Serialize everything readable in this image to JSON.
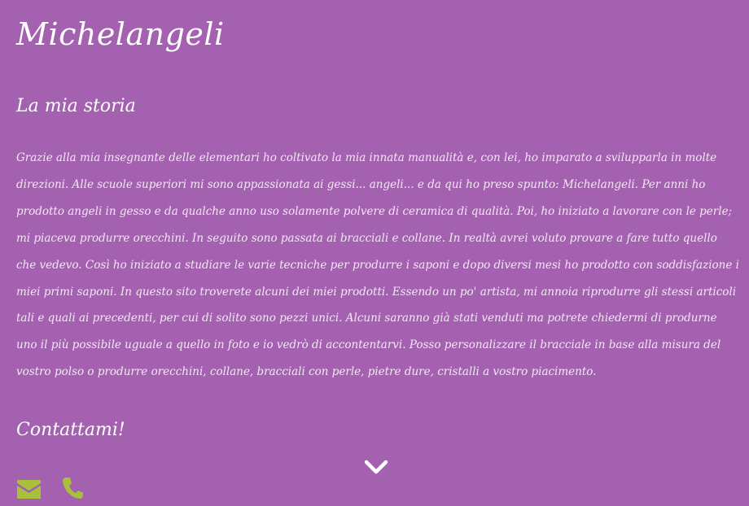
{
  "site": {
    "title": "Michelangeli"
  },
  "story": {
    "title": "La mia storia",
    "text": "Grazie alla mia insegnante delle elementari ho coltivato la mia innata manualità e, con lei, ho imparato a svilupparla in molte direzioni. Alle scuole superiori mi sono appassionata ai gessi... angeli... e da qui ho preso spunto: Michelangeli. Per anni ho prodotto angeli in gesso e da qualche anno uso solamente polvere di ceramica di qualità. Poi, ho iniziato a lavorare con le perle; mi piaceva produrre orecchini. In seguito sono passata ai bracciali e collane. In realtà avrei voluto provare a fare tutto quello che vedevo. Così ho iniziato a studiare le varie tecniche per produrre i saponi e dopo diversi mesi ho prodotto con soddisfazione i miei primi saponi. In questo sito troverete alcuni dei miei prodotti. Essendo un po' artista, mi annoia riprodurre gli stessi articoli tali e quali ai precedenti, per cui di solito sono pezzi unici. Alcuni saranno già stati venduti ma potrete chiedermi di produrne uno il più possibile uguale a quello in foto e io vedrò di accontentarvi. Posso personalizzare il bracciale in base alla misura del vostro polso o produrre orecchini, collane, bracciali con perle, pietre dure, cristalli a vostro piacimento."
  },
  "contact": {
    "title": "Contattami!",
    "icons": [
      "envelope-icon",
      "phone-icon"
    ]
  },
  "scroll": {
    "icon": "chevron-down-icon"
  },
  "colors": {
    "background": "#a461b0",
    "text": "#ffffff",
    "icon_accent": "#a9c03b"
  }
}
